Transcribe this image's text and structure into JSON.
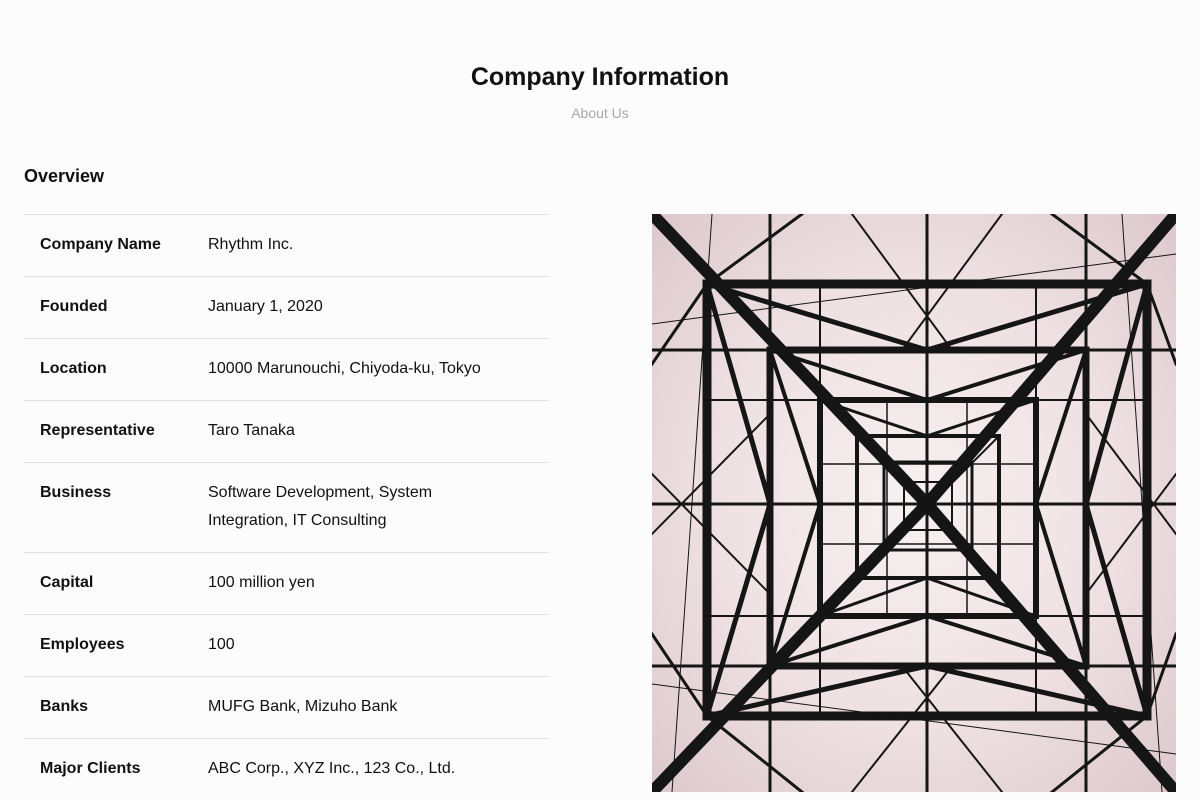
{
  "header": {
    "title": "Company Information",
    "subtitle": "About Us"
  },
  "overview": {
    "heading": "Overview",
    "rows": [
      {
        "label": "Company Name",
        "value": "Rhythm Inc."
      },
      {
        "label": "Founded",
        "value": "January 1, 2020"
      },
      {
        "label": "Location",
        "value": "10000 Marunouchi, Chiyoda-ku, Tokyo"
      },
      {
        "label": "Representative",
        "value": "Taro Tanaka"
      },
      {
        "label": "Business",
        "value": "Software Development, System Integration, IT Consulting"
      },
      {
        "label": "Capital",
        "value": "100 million yen"
      },
      {
        "label": "Employees",
        "value": "100"
      },
      {
        "label": "Banks",
        "value": "MUFG Bank, Mizuho Bank"
      },
      {
        "label": "Major Clients",
        "value": "ABC Corp., XYZ Inc., 123 Co., Ltd."
      }
    ]
  },
  "image": {
    "subject": "steel-lattice-tower-photo"
  }
}
